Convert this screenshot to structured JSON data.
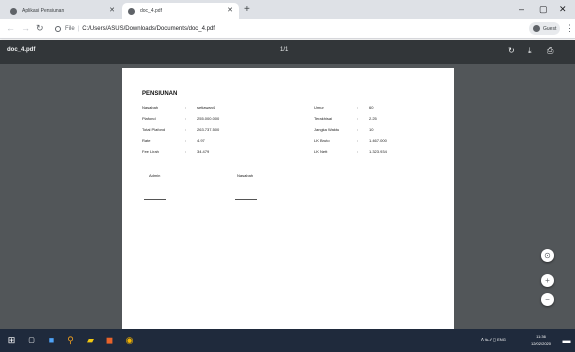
{
  "browser": {
    "tabs": [
      {
        "title": "Aplikasi Pensiunan",
        "active": false
      },
      {
        "title": "doc_4.pdf",
        "active": true
      }
    ],
    "new_tab": "+",
    "controls": {
      "minimize": "–",
      "maximize": "▢",
      "close": "✕"
    },
    "address": {
      "scheme_label": "File",
      "path": "C:/Users/ASUS/Downloads/Documents/doc_4.pdf"
    },
    "profile": "Guest"
  },
  "pdf_toolbar": {
    "filename": "doc_4.pdf",
    "page_indicator": "1/1"
  },
  "document": {
    "heading": "PENSIUNAN",
    "left_fields": [
      {
        "label": "Nasabah",
        "value": "setiawan4"
      },
      {
        "label": "Plafond",
        "value": "255.000.000"
      },
      {
        "label": "Total Plafond",
        "value": "263.737.500"
      },
      {
        "label": "Rate",
        "value": "4.97"
      },
      {
        "label": "Fee Lirah",
        "value": "34.479"
      }
    ],
    "right_fields": [
      {
        "label": "Umur",
        "value": "60"
      },
      {
        "label": "Terakhisai",
        "value": "2.25"
      },
      {
        "label": "Jangka Waktu",
        "value": "10"
      },
      {
        "label": "LK Bruto",
        "value": "1.467.000"
      },
      {
        "label": "LK Nett",
        "value": "1.323.934"
      }
    ],
    "signatures": [
      "Admin",
      "Nasabah"
    ]
  },
  "taskbar": {
    "tray_text": "ᐱ  ℡  ⁄⁄  ◻  ENG",
    "time": "11:36",
    "date": "12/02/2020"
  },
  "colors": {
    "pdf_toolbar": "#323639",
    "viewer_bg": "#525659",
    "taskbar": "#1f2a3c"
  }
}
